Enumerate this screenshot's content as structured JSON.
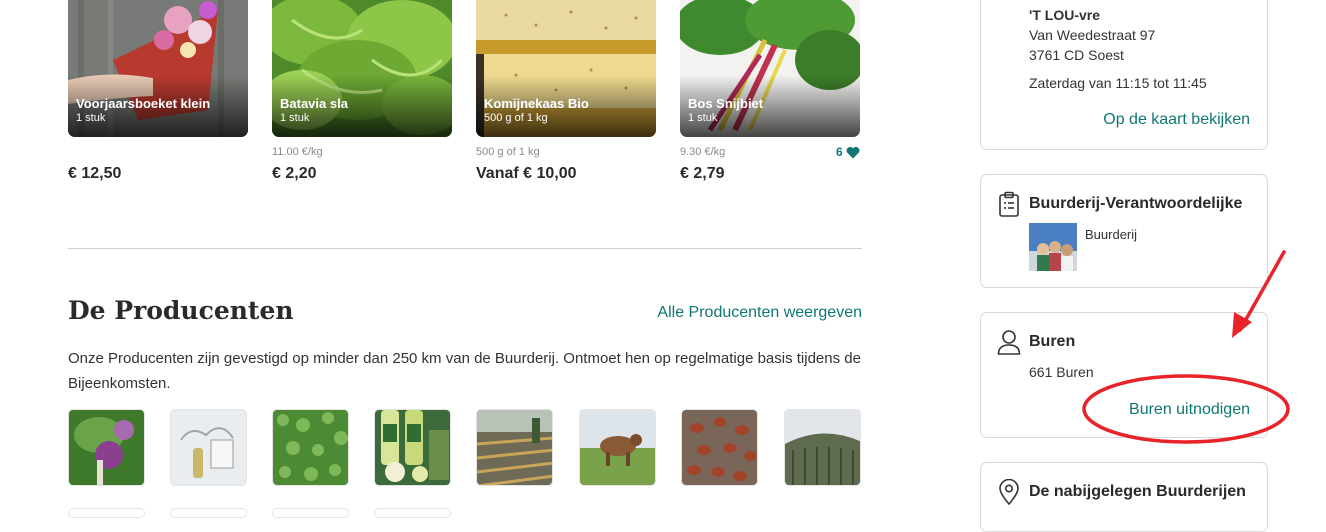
{
  "products": [
    {
      "name": "Voorjaarsboeket klein",
      "qty": "1 stuk",
      "unit_price": "",
      "price": "€ 12,50",
      "likes": ""
    },
    {
      "name": "Batavia sla",
      "qty": "1 stuk",
      "unit_price": "11.00 €/kg",
      "price": "€ 2,20",
      "likes": ""
    },
    {
      "name": "Komijnekaas Bio",
      "qty": "500 g of 1 kg",
      "unit_price": "500 g of 1 kg",
      "price": "Vanaf € 10,00",
      "likes": ""
    },
    {
      "name": "Bos Snijbiet",
      "qty": "1 stuk",
      "unit_price": "9.30 €/kg",
      "price": "€ 2,79",
      "likes": "6"
    }
  ],
  "producers": {
    "title": "De Producenten",
    "all_link": "Alle Producenten weergeven",
    "intro": "Onze Producenten zijn gevestigd op minder dan 250 km van de Buurderij. Ontmoet hen op regelmatige basis tijdens de Bijeenkomsten."
  },
  "location": {
    "name": "'T LOU-vre",
    "street": "Van Weedestraat 97",
    "city": "3761 CD Soest",
    "schedule": "Zaterdag van 11:15 tot 11:45",
    "map_link": "Op de kaart bekijken"
  },
  "host": {
    "title": "Buurderij-Verantwoordelijke",
    "label": "Buurderij"
  },
  "neighbours": {
    "title": "Buren",
    "count": "661 Buren",
    "invite_link": "Buren uitnodigen"
  },
  "nearby": {
    "title": "De nabijgelegen Buurderijen"
  },
  "colors": {
    "accent": "#0f7773",
    "annotation": "#e8232a"
  },
  "icons": {
    "host": "clipboard-icon",
    "neighbours": "user-icon",
    "nearby": "map-pin-icon",
    "likes": "heart-icon"
  }
}
